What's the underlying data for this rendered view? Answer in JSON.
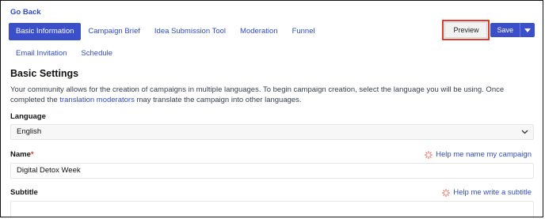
{
  "nav": {
    "go_back": "Go Back"
  },
  "tabs": {
    "row1": [
      "Basic Information",
      "Campaign Brief",
      "Idea Submission Tool",
      "Moderation",
      "Funnel"
    ],
    "row2": [
      "Email Invitation",
      "Schedule"
    ],
    "active": "Basic Information"
  },
  "actions": {
    "preview_label": "Preview",
    "save_label": "Save"
  },
  "section": {
    "title": "Basic Settings",
    "description_before": "Your community allows for the creation of campaigns in multiple languages. To begin campaign creation, select the language you will be using. Once completed the ",
    "description_link": "translation moderators",
    "description_after": " may translate the campaign into other languages."
  },
  "language": {
    "label": "Language",
    "value": "English"
  },
  "name": {
    "label": "Name",
    "required_marker": "*",
    "value": "Digital Detox Week",
    "helper": "Help me name my campaign"
  },
  "subtitle": {
    "label": "Subtitle",
    "value": "",
    "helper": "Help me write a subtitle"
  },
  "colors": {
    "accent": "#3a4fc9",
    "link": "#2f4bc6",
    "highlight": "#e23a2a"
  }
}
